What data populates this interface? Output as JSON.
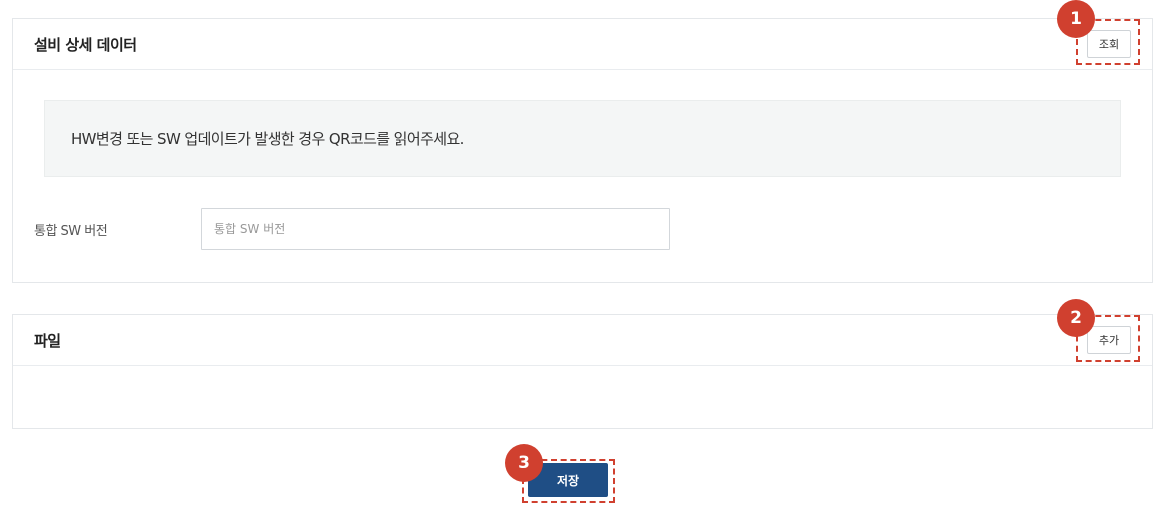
{
  "detail_panel": {
    "title": "설비 상세 데이터",
    "lookup_label": "조회",
    "notice": "HW변경 또는 SW 업데이트가 발생한 경우 QR코드를 읽어주세요.",
    "sw_version": {
      "label": "통합 SW 버전",
      "value": "",
      "placeholder": "통합 SW 버전"
    }
  },
  "file_panel": {
    "title": "파일",
    "add_label": "추가"
  },
  "save_label": "저장",
  "markers": [
    "1",
    "2",
    "3"
  ],
  "colors": {
    "primary": "#1f4e85",
    "highlight": "#d0402f",
    "notice_bg": "#f4f6f6"
  }
}
